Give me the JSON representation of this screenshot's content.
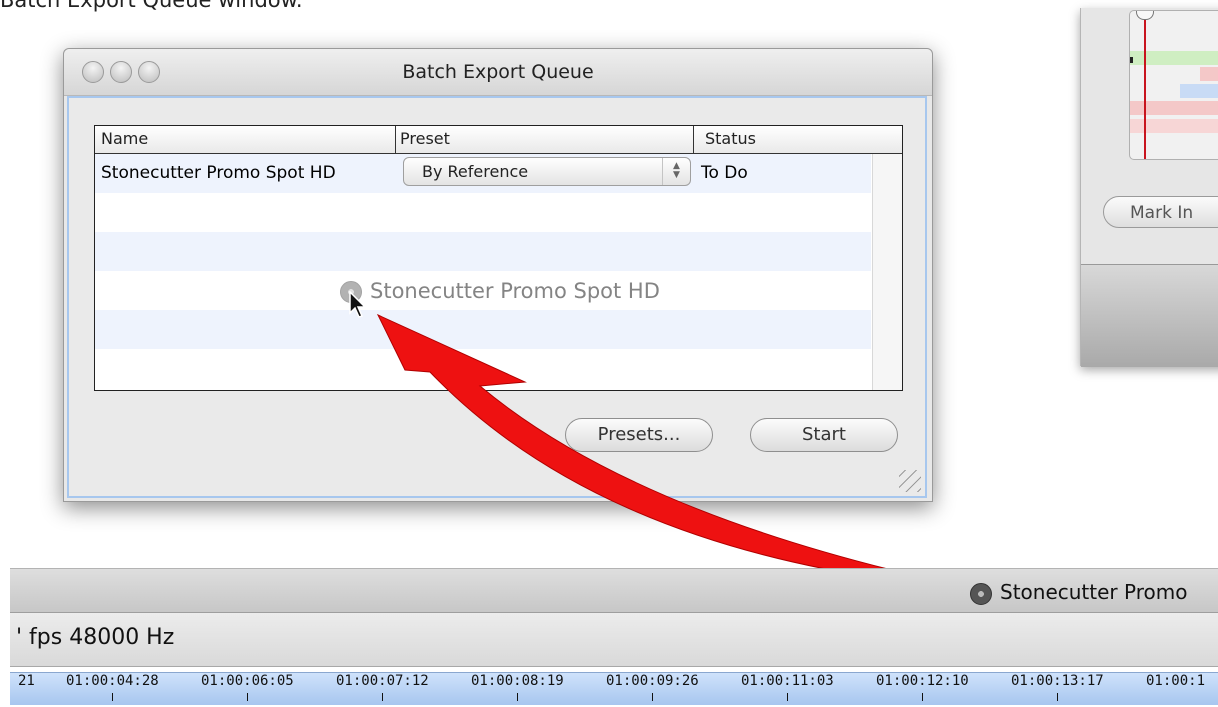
{
  "caption": "Batch Export Queue window.",
  "window": {
    "title": "Batch Export Queue",
    "columns": [
      "Name",
      "Preset",
      "Status"
    ],
    "rows": [
      {
        "name": "Stonecutter Promo Spot HD",
        "preset": "By Reference",
        "status": "To Do"
      }
    ],
    "buttons": {
      "presets": "Presets...",
      "start": "Start"
    }
  },
  "drag_ghost_label": "Stonecutter Promo Spot HD",
  "background_window": {
    "mark_in_label": "Mark In"
  },
  "timeline": {
    "clip_label": "Stonecutter Promo",
    "info": "' fps  48000 Hz",
    "timecodes": [
      "21",
      "01:00:04:28",
      "01:00:06:05",
      "01:00:07:12",
      "01:00:08:19",
      "01:00:09:26",
      "01:00:11:03",
      "01:00:12:10",
      "01:00:13:17",
      "01:00:1"
    ]
  },
  "colors": {
    "arrow": "#ee1111",
    "focus_ring": "#a7c7ee",
    "row_alt": "#eef3fd",
    "ruler": "#a7c6ef"
  },
  "icons": [
    "film-reel-icon",
    "arrow-cursor-icon",
    "resize-grip-icon"
  ]
}
